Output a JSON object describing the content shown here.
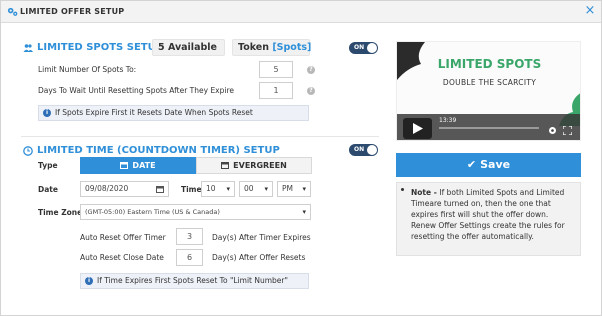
{
  "window": {
    "title": "LIMITED OFFER SETUP",
    "close_label": "×"
  },
  "limited_spots": {
    "title": "LIMITED SPOTS SETUP",
    "available_count": "5",
    "available_label": "Available",
    "token_label": "Token",
    "token_value": "[Spots]",
    "toggle_label": "ON",
    "limit_label": "Limit Number Of Spots To:",
    "limit_value": "5",
    "wait_label": "Days To Wait Until Resetting Spots After They Expire",
    "wait_value": "1",
    "info": "If Spots Expire First it Resets Date When Spots Reset"
  },
  "countdown": {
    "title": "LIMITED TIME (COUNTDOWN TIMER) SETUP",
    "toggle_label": "ON",
    "type_label": "Type",
    "type_date": "DATE",
    "type_evergreen": "EVERGREEN",
    "date_label": "Date",
    "date_value": "09/08/2020",
    "time_label": "Time",
    "hour": "10",
    "minute": "00",
    "ampm": "PM",
    "timezone_label": "Time Zone",
    "timezone_value": "(GMT-05:00) Eastern Time (US & Canada)",
    "auto_reset_timer_label": "Auto Reset Offer Timer",
    "auto_reset_timer_value": "3",
    "auto_reset_timer_suffix": "Day(s) After Timer Expires",
    "auto_reset_close_label": "Auto Reset Close Date",
    "auto_reset_close_value": "6",
    "auto_reset_close_suffix": "Day(s) After Offer Resets",
    "info": "If Time Expires First Spots Reset To \"Limit Number\""
  },
  "video": {
    "heading": "LIMITED SPOTS",
    "subheading": "DOUBLE THE SCARCITY",
    "timestamp": "13:39"
  },
  "save_label": "Save",
  "note": {
    "bold": "Note - ",
    "text": "If both Limited Spots and Limited Timeare turned on, then the one that expires first will shut the offer down. Renew Offer Settings create the rules for resetting the offer automatically."
  },
  "colors": {
    "accent": "#2f8fd8",
    "toggle": "#2c4a6e",
    "brand_green": "#3aa66a"
  }
}
